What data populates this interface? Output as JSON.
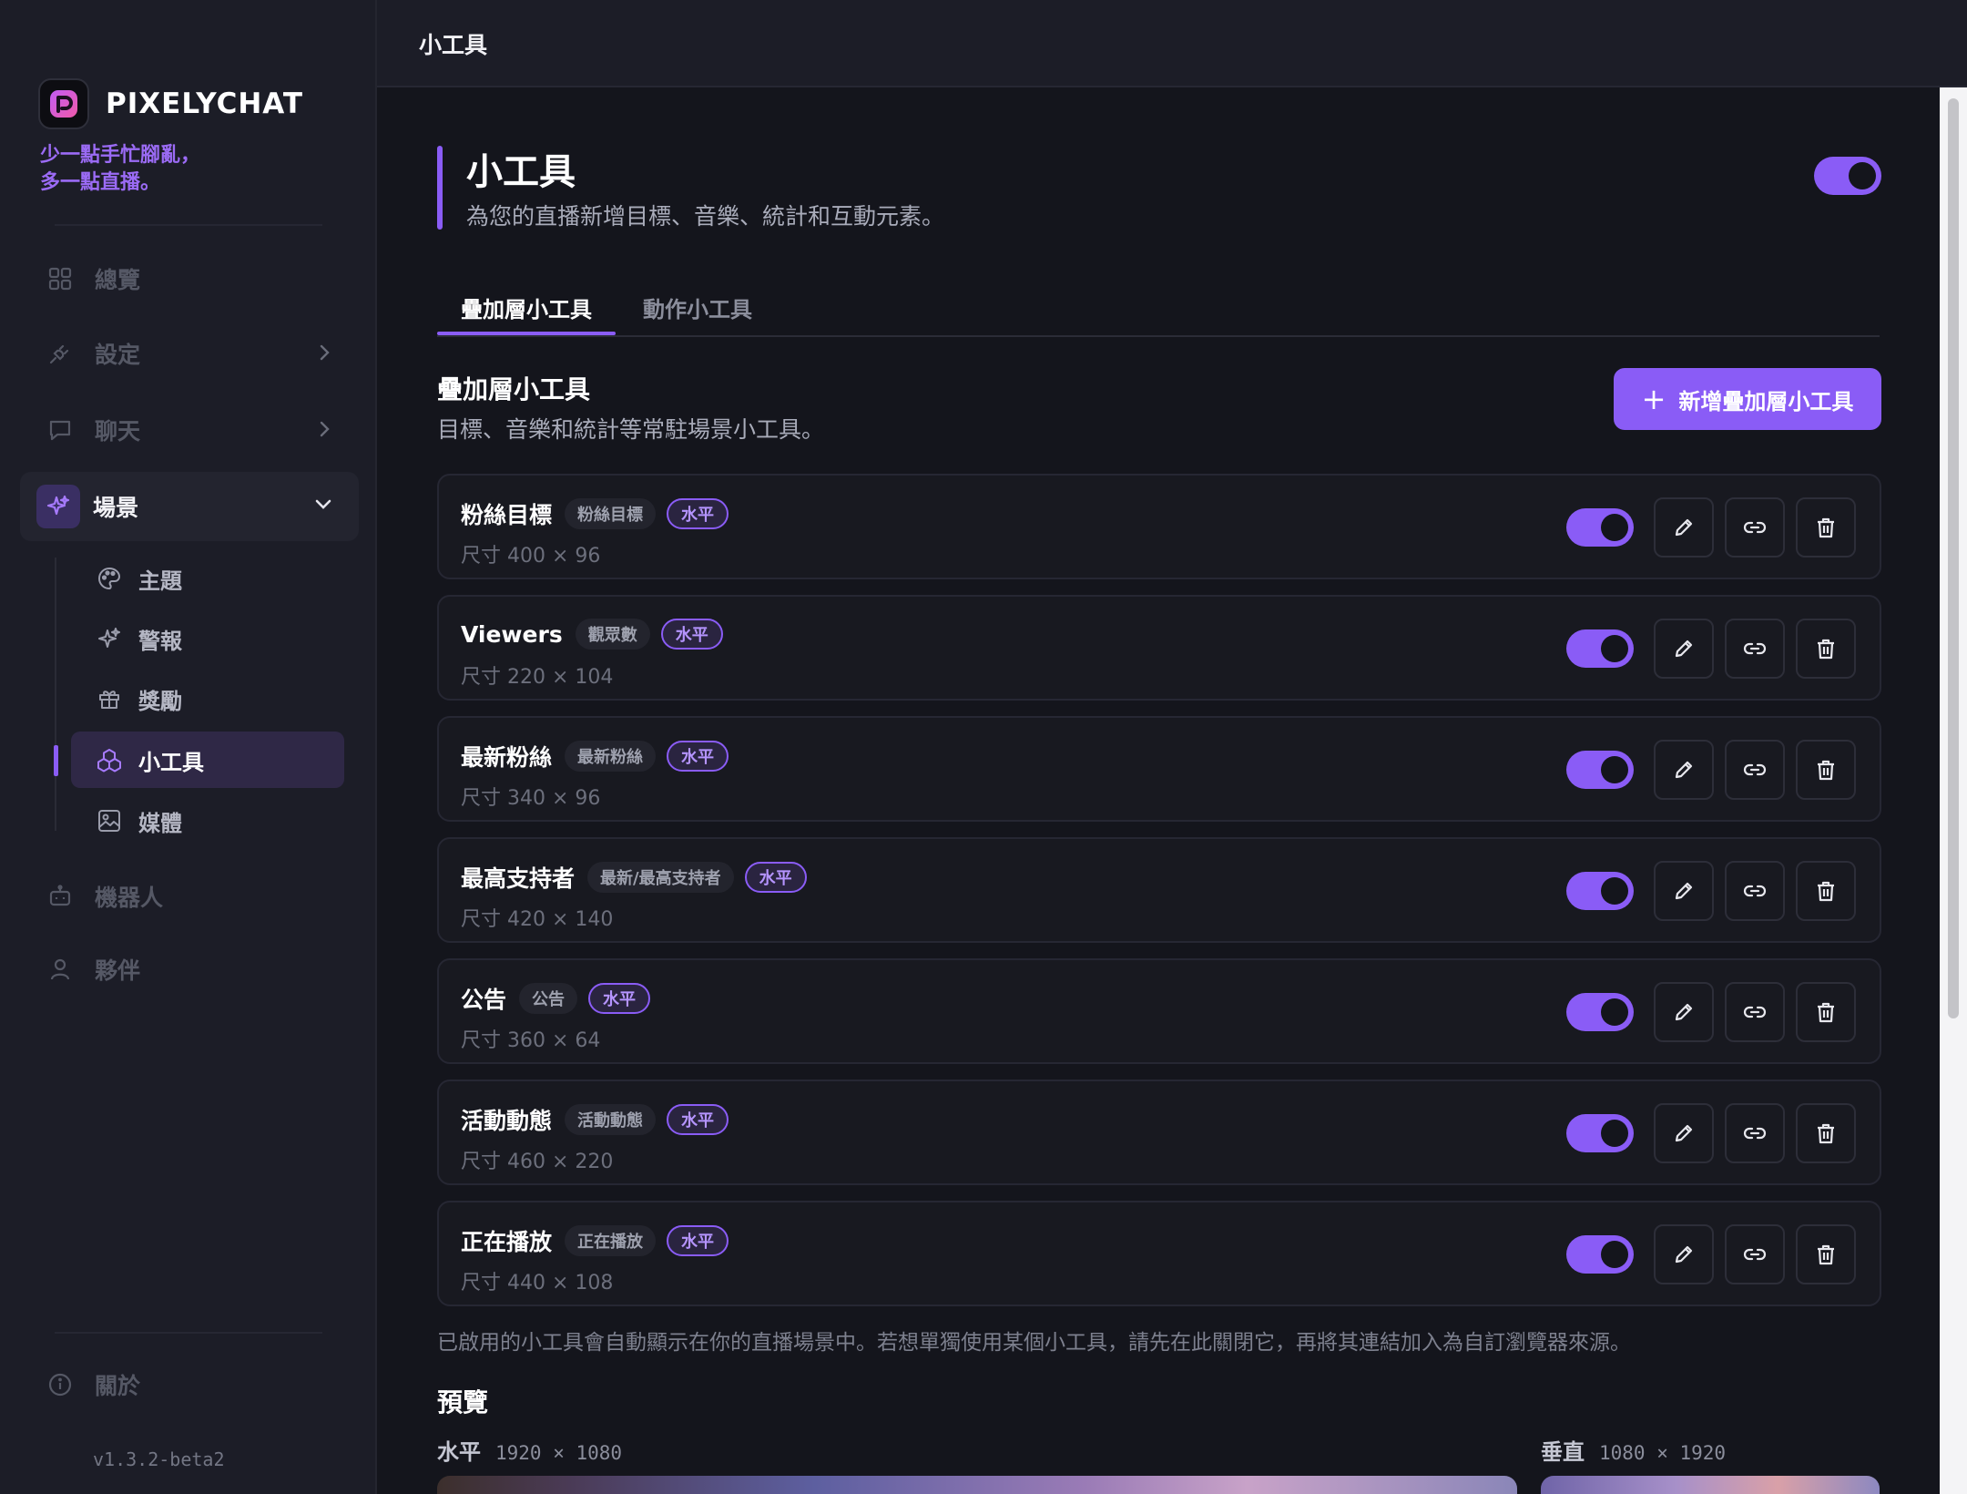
{
  "app": {
    "name": "PIXELYCHAT",
    "tagline": [
      "少一點手忙腳亂，",
      "多一點直播。"
    ],
    "version": "v1.3.2-beta2"
  },
  "header": {
    "title": "小工具"
  },
  "nav": {
    "overview": "總覽",
    "settings": "設定",
    "chat": "聊天",
    "scenes": "場景",
    "scene_items": [
      {
        "label": "主題",
        "icon": "palette-icon"
      },
      {
        "label": "警報",
        "icon": "sparkles-icon"
      },
      {
        "label": "獎勵",
        "icon": "gift-icon"
      },
      {
        "label": "小工具",
        "icon": "widgets-icon",
        "active": true
      },
      {
        "label": "媒體",
        "icon": "image-icon"
      }
    ],
    "bots": "機器人",
    "partner": "夥伴",
    "about": "關於"
  },
  "page": {
    "title": "小工具",
    "subtitle": "為您的直播新增目標、音樂、統計和互動元素。",
    "enabled": true,
    "tabs": [
      "疊加層小工具",
      "動作小工具"
    ],
    "active_tab": 0
  },
  "section": {
    "title": "疊加層小工具",
    "subtitle": "目標、音樂和統計等常駐場景小工具。",
    "add_button": "新增疊加層小工具"
  },
  "widgets": [
    {
      "name": "粉絲目標",
      "type": "粉絲目標",
      "orientation": "水平",
      "size": "尺寸 400 × 96",
      "enabled": true
    },
    {
      "name": "Viewers",
      "type": "觀眾數",
      "orientation": "水平",
      "size": "尺寸 220 × 104",
      "enabled": true
    },
    {
      "name": "最新粉絲",
      "type": "最新粉絲",
      "orientation": "水平",
      "size": "尺寸 340 × 96",
      "enabled": true
    },
    {
      "name": "最高支持者",
      "type": "最新/最高支持者",
      "orientation": "水平",
      "size": "尺寸 420 × 140",
      "enabled": true
    },
    {
      "name": "公告",
      "type": "公告",
      "orientation": "水平",
      "size": "尺寸 360 × 64",
      "enabled": true
    },
    {
      "name": "活動動態",
      "type": "活動動態",
      "orientation": "水平",
      "size": "尺寸 460 × 220",
      "enabled": true
    },
    {
      "name": "正在播放",
      "type": "正在播放",
      "orientation": "水平",
      "size": "尺寸 440 × 108",
      "enabled": true
    }
  ],
  "note": "已啟用的小工具會自動顯示在你的直播場景中。若想單獨使用某個小工具，請先在此關閉它，再將其連結加入為自訂瀏覽器來源。",
  "preview": {
    "title": "預覽",
    "horizontal": {
      "label": "水平",
      "dims": "1920 × 1080"
    },
    "vertical": {
      "label": "垂直",
      "dims": "1080 × 1920"
    }
  },
  "colors": {
    "accent": "#8a5cf6",
    "background": "#14151c",
    "sidebar": "#1c1d27"
  }
}
